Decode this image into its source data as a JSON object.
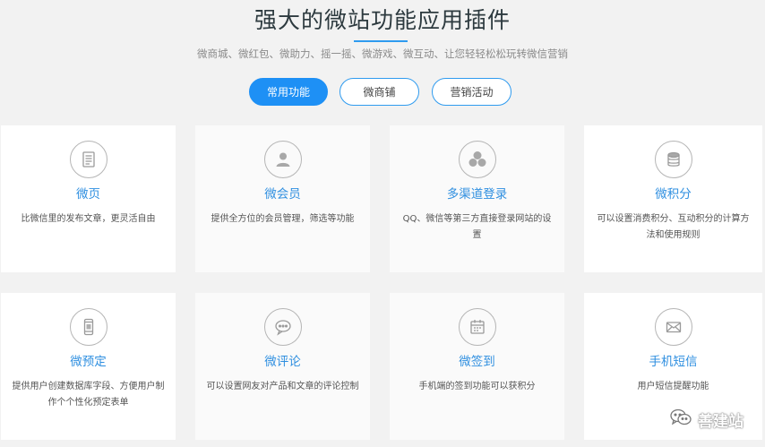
{
  "header": {
    "title": "强大的微站功能应用插件",
    "subtitle": "微商城、微红包、微助力、摇一摇、微游戏、微互动、让您轻轻松松玩转微信营销"
  },
  "tabs": [
    {
      "label": "常用功能",
      "active": true
    },
    {
      "label": "微商铺",
      "active": false
    },
    {
      "label": "营销活动",
      "active": false
    }
  ],
  "cards": [
    {
      "icon": "document-icon",
      "title": "微页",
      "desc": "比微信里的发布文章，更灵活自由"
    },
    {
      "icon": "user-icon",
      "title": "微会员",
      "desc": "提供全方位的会员管理，筛选等功能"
    },
    {
      "icon": "multi-login-icon",
      "title": "多渠道登录",
      "desc": "QQ、微信等第三方直接登录网站的设置"
    },
    {
      "icon": "coins-icon",
      "title": "微积分",
      "desc": "可以设置消费积分、互动积分的计算方法和使用规则"
    },
    {
      "icon": "phone-icon",
      "title": "微预定",
      "desc": "提供用户创建数据库字段、方便用户制作个个性化预定表单"
    },
    {
      "icon": "comment-icon",
      "title": "微评论",
      "desc": "可以设置网友对产品和文章的评论控制"
    },
    {
      "icon": "calendar-icon",
      "title": "微签到",
      "desc": "手机端的签到功能可以获积分"
    },
    {
      "icon": "mail-icon",
      "title": "手机短信",
      "desc": "用户短信提醒功能"
    }
  ],
  "watermark": {
    "text": "善建站",
    "icon": "wechat-icon"
  },
  "colors": {
    "accent": "#1e90f5",
    "card_title": "#2f8fe0",
    "background": "#f2f2f2"
  }
}
